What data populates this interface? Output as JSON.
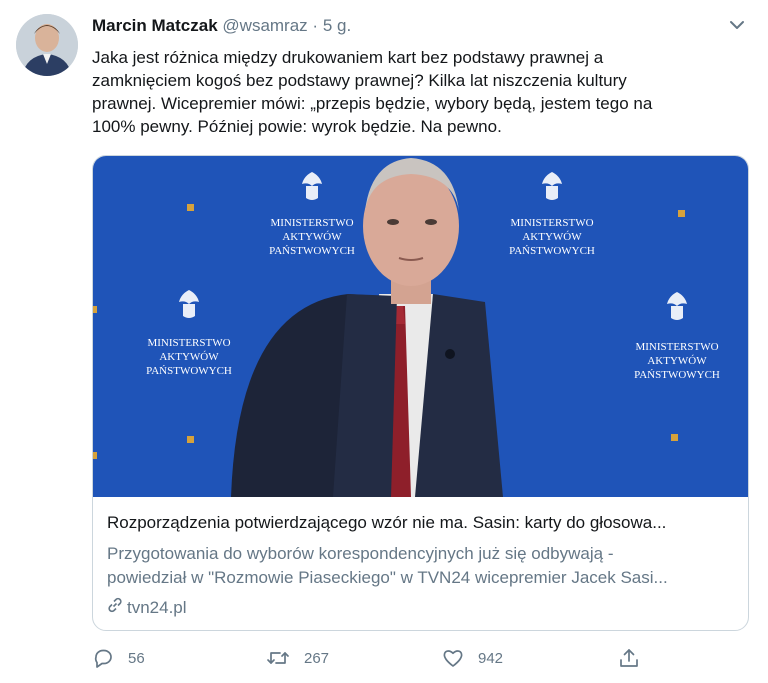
{
  "tweet": {
    "author_name": "Marcin Matczak",
    "author_handle": "@wsamraz",
    "separator": "·",
    "time": "5 g.",
    "text_lines": [
      "Jaka jest różnica między drukowaniem kart bez podstawy prawnej a",
      "zamknięciem kogoś bez podstawy prawnej? Kilka lat niszczenia kultury",
      "prawnej. Wicepremier mówi: „przepis będzie, wybory będą, jestem tego na",
      "100% pewny. Później powie: wyrok będzie. Na pewno."
    ]
  },
  "card": {
    "backdrop_text": [
      "MINISTERSTWO",
      "AKTYWÓW",
      "PAŃSTWOWYCH"
    ],
    "title": "Rozporządzenia potwierdzającego wzór nie ma. Sasin: karty do głosowa...",
    "description_lines": [
      "Przygotowania do wyborów korespondencyjnych już się odbywają -",
      "powiedział w \"Rozmowie Piaseckiego\" w TVN24 wicepremier Jacek Sasi..."
    ],
    "domain": "tvn24.pl"
  },
  "actions": {
    "replies": "56",
    "retweets": "267",
    "likes": "942"
  },
  "colors": {
    "backdrop_blue": "#1f54b8",
    "accent_gold": "#d6a23c",
    "muted": "#657786"
  },
  "icons": [
    "chevron-down-icon",
    "link-icon",
    "reply-icon",
    "retweet-icon",
    "like-icon",
    "share-icon"
  ]
}
